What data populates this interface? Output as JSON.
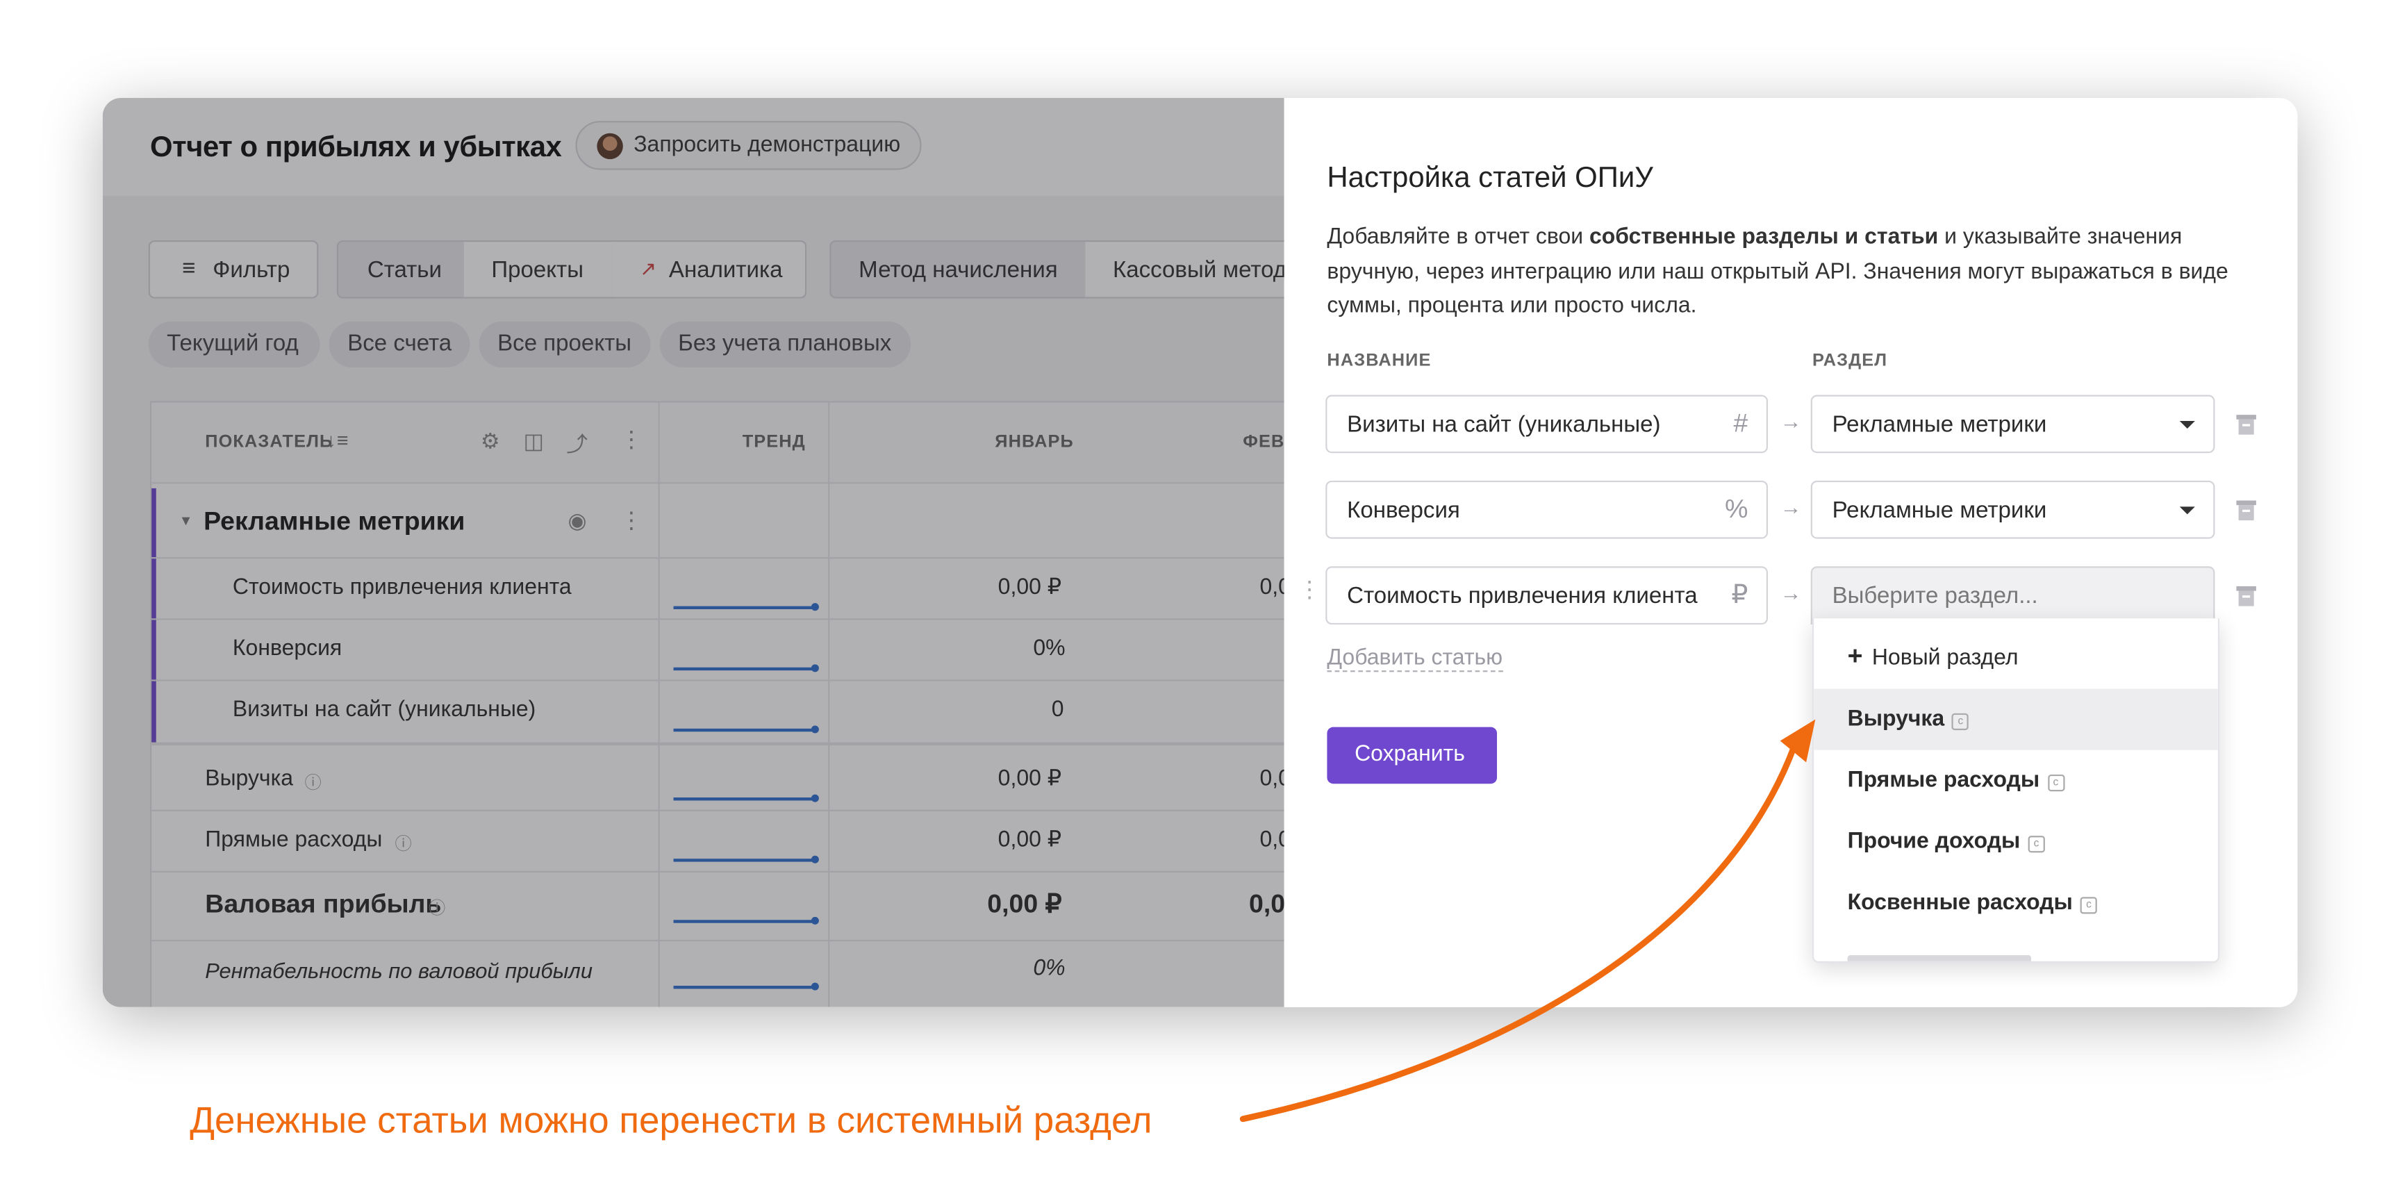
{
  "left": {
    "title": "Отчет о прибылях и убытках",
    "demo_label": "Запросить демонстрацию",
    "toolbar": {
      "filter": "Фильтр",
      "tab_items": "Статьи",
      "tab_projects": "Проекты",
      "tab_analytics": "Аналитика",
      "method_accrual": "Метод начисления",
      "method_cash": "Кассовый метод"
    },
    "chips": [
      "Текущий год",
      "Все счета",
      "Все проекты",
      "Без учета плановых"
    ],
    "table": {
      "col_indicator": "ПОКАЗАТЕЛЬ",
      "col_trend": "ТРЕНД",
      "col_january": "ЯНВАРЬ",
      "col_february": "ФЕВ",
      "group": "Рекламные метрики",
      "rows": [
        {
          "label": "Стоимость привлечения клиента",
          "jan": "0,00 ₽",
          "feb": "0,0"
        },
        {
          "label": "Конверсия",
          "jan": "0%",
          "feb": ""
        },
        {
          "label": "Визиты на сайт (уникальные)",
          "jan": "0",
          "feb": ""
        },
        {
          "label": "Выручка",
          "jan": "0,00 ₽",
          "feb": "0,0"
        },
        {
          "label": "Прямые расходы",
          "jan": "0,00 ₽",
          "feb": "0,0"
        },
        {
          "label": "Валовая прибыль",
          "jan": "0,00 ₽",
          "feb": "0,0"
        },
        {
          "label": "Рентабельность по валовой прибыли",
          "jan": "0%",
          "feb": ""
        }
      ]
    }
  },
  "panel": {
    "title": "Настройка статей ОПиУ",
    "desc_1": "Добавляйте в отчет свои ",
    "desc_bold": "собственные разделы и статьи",
    "desc_2": " и указывайте значения",
    "desc_line2": "вручную, через интеграцию или наш открытый API. Значения могут выражаться в виде",
    "desc_line3": "суммы, процента или просто числа.",
    "col_name": "НАЗВАНИЕ",
    "col_section": "РАЗДЕЛ",
    "items": [
      {
        "name": "Визиты на сайт (уникальные)",
        "type_icon": "#",
        "section": "Рекламные метрики"
      },
      {
        "name": "Конверсия",
        "type_icon": "%",
        "section": "Рекламные метрики"
      },
      {
        "name": "Стоимость привлечения клиента",
        "type_icon": "₽",
        "section_placeholder": "Выберите раздел..."
      }
    ],
    "add_item": "Добавить статью",
    "save": "Сохранить",
    "dropdown": {
      "new_section": "Новый раздел",
      "options": [
        "Выручка",
        "Прямые расходы",
        "Прочие доходы",
        "Косвенные расходы"
      ]
    }
  },
  "annotation": "Денежные статьи можно перенести в системный раздел",
  "colors": {
    "accent_purple": "#7048d0",
    "annotation_orange": "#f06a10",
    "trend_blue": "#2e6fd1"
  }
}
